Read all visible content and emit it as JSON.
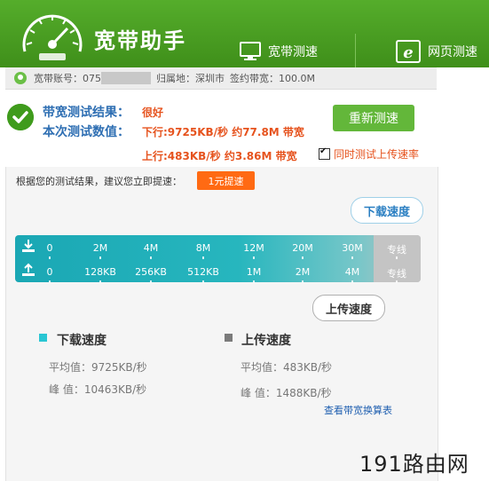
{
  "app": {
    "title": "宽带助手"
  },
  "tabs": [
    {
      "label": "宽带测速",
      "icon": "monitor-icon"
    },
    {
      "label": "网页测速",
      "icon": "ie-browser-icon"
    }
  ],
  "info": {
    "account_label": "宽带账号：",
    "account_value": "075",
    "location_label": "归属地：",
    "location_value": "深圳市",
    "contracted_label": "签约带宽：",
    "contracted_value": "100.0M"
  },
  "result": {
    "label_result": "带宽测试结果：",
    "result_value": "很好",
    "label_current": "本次测试数值：",
    "download_value": "下行:9725KB/秒 约77.8M 带宽",
    "upload_value": "上行:483KB/秒 约3.86M 带宽",
    "retest_button": "重新测速",
    "upload_checkbox_label": "同时测试上传速率",
    "upload_checkbox_checked": true
  },
  "advice": {
    "text": "根据您的测试结果，建议您立即提速：",
    "boost_button": "1元提速"
  },
  "meter": {
    "download_bubble": "下载速度",
    "upload_bubble": "上传速度",
    "download_ticks": [
      "0",
      "2M",
      "4M",
      "8M",
      "12M",
      "20M",
      "30M",
      "专线"
    ],
    "upload_ticks": [
      "0",
      "128KB",
      "256KB",
      "512KB",
      "1M",
      "2M",
      "4M",
      "专线"
    ],
    "download_level_fraction": 0.93,
    "upload_level_fraction": 0.72
  },
  "stats": {
    "download": {
      "title": "下载速度",
      "avg": "平均值：9725KB/秒",
      "peak": "峰 值：10463KB/秒"
    },
    "upload": {
      "title": "上传速度",
      "avg": "平均值：483KB/秒",
      "peak": "峰  值：1488KB/秒"
    },
    "link": "查看带宽换算表"
  },
  "colors": {
    "brand_green": "#4aa225",
    "download_legend": "#29c6d3",
    "upload_legend": "#7b7b7b",
    "accent_orange": "#ff6a13"
  },
  "watermark": "191路由网"
}
